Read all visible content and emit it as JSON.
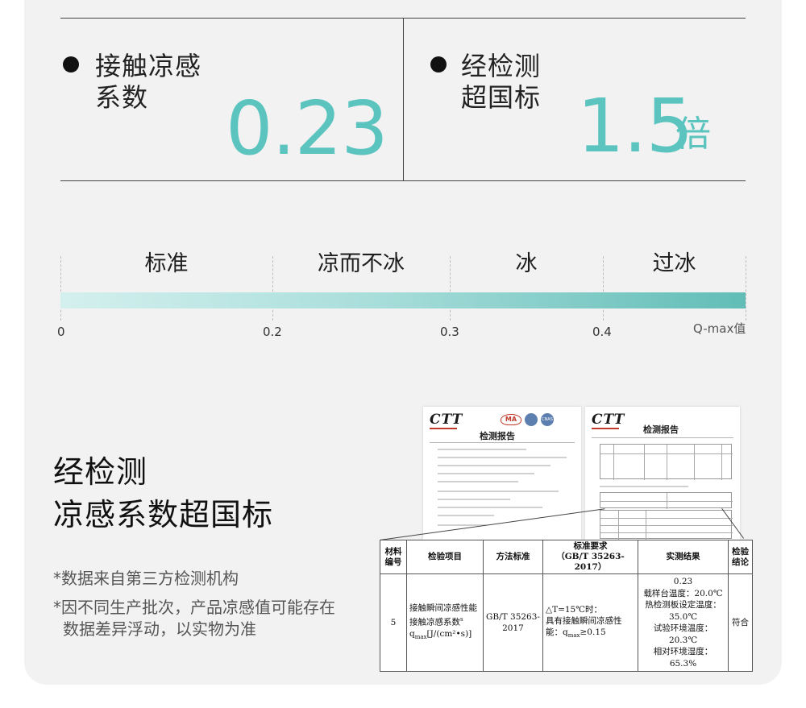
{
  "stats": [
    {
      "label_line1": "接触凉感",
      "label_line2": "系数",
      "value": "0.23",
      "unit": ""
    },
    {
      "label_line1": "经检测",
      "label_line2": "超国标",
      "value": "1.5",
      "unit": "倍"
    }
  ],
  "scale": {
    "categories": [
      "标准",
      "凉而不冰",
      "冰",
      "过冰"
    ],
    "ticks": [
      "0",
      "0.2",
      "0.3",
      "0.4"
    ],
    "axis_label": "Q-max值"
  },
  "bottom": {
    "headline_line1": "经检测",
    "headline_line2": "凉感系数超国标",
    "note1": "*数据来自第三方检测机构",
    "note2_line1": "*因不同生产批次，产品凉感值可能存在",
    "note2_line2": "数据差异浮动，以实物为准"
  },
  "documents": {
    "logo_text": "CTT",
    "title": "检测报告",
    "ma_text": "MA",
    "cnas_text": "CNAS"
  },
  "test_table": {
    "headers": [
      "材料\n编号",
      "检验项目",
      "方法标准",
      "标准要求\n（GB/T 35263-2017）",
      "实测结果",
      "检验\n结论"
    ],
    "row": {
      "id": "5",
      "item_line1": "接触瞬间凉感性能",
      "item_line2": "接触凉感系数",
      "item_sup": "s",
      "item_line3_prefix": "q",
      "item_line3_sub": "max",
      "item_line3_suffix": "[J/(cm²•s)]",
      "method": "GB/T 35263-2017",
      "req_line1": "△T=15℃时：",
      "req_line2": "具有接触瞬间凉感性",
      "req_line3_prefix": "能：q",
      "req_line3_sub": "max",
      "req_line3_suffix": "≥0.15",
      "result_line1": "0.23",
      "result_line2": "载样台温度：20.0℃",
      "result_line3": "热检测板设定温度：",
      "result_line4": "35.0℃",
      "result_line5": "试验环境温度：20.3℃",
      "result_line6": "相对环境湿度：65.3%",
      "conclusion": "符合"
    }
  },
  "colors": {
    "accent": "#5cc4bf",
    "panel": "#f2f2f2"
  }
}
